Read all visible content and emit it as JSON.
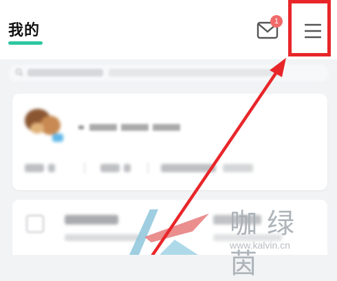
{
  "header": {
    "title": "我的",
    "message_badge": "1",
    "message_icon": "mail-icon",
    "menu_icon": "hamburger-menu-icon"
  },
  "annotation": {
    "highlight_color": "#e8262a",
    "arrow_color": "#e8262a"
  },
  "accent_color": "#2fc7a0",
  "watermark": {
    "brand": "咖绿茵",
    "url": "www.kalvin.cn"
  }
}
